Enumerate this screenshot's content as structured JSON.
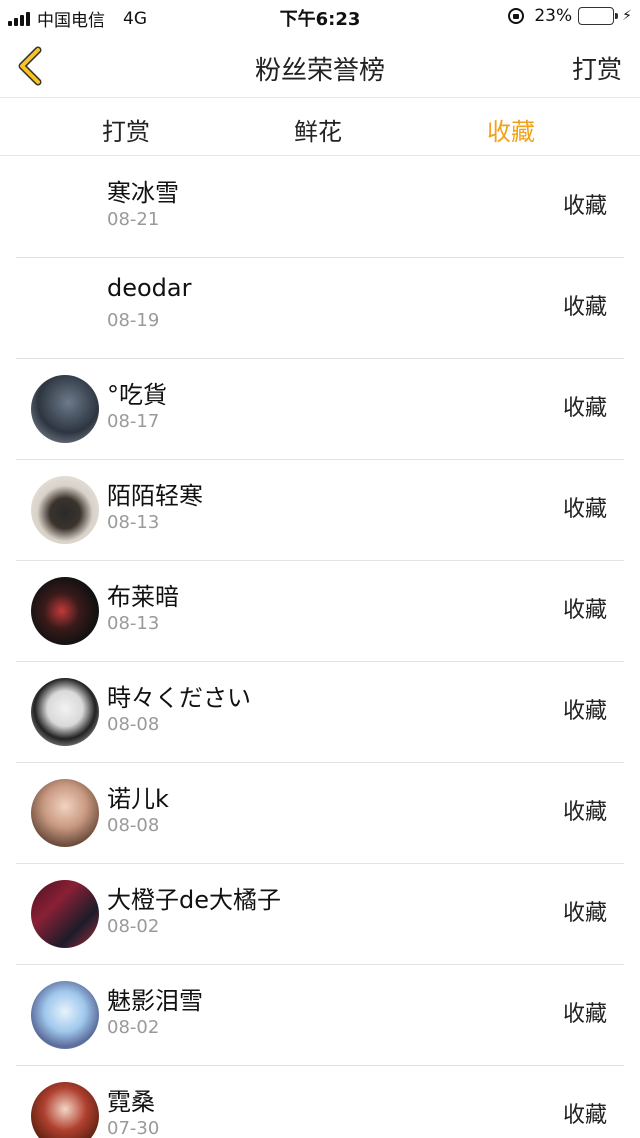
{
  "status_bar": {
    "carrier": "中国电信",
    "network": "4G",
    "time": "下午6:23",
    "battery": "23%",
    "battery_level": 0.23
  },
  "nav": {
    "back_icon": "chevron-left-icon",
    "title": "粉丝荣誉榜",
    "action": "打赏"
  },
  "tabs": [
    {
      "label": "打赏",
      "active": false
    },
    {
      "label": "鲜花",
      "active": false
    },
    {
      "label": "收藏",
      "active": true
    }
  ],
  "colors": {
    "accent": "#f0a21b",
    "back_icon": "#f7c325"
  },
  "list": [
    {
      "name": "寒冰雪",
      "date": "08-21",
      "action": "收藏",
      "avatar": "none"
    },
    {
      "name": "deodar",
      "date": "08-19",
      "action": "收藏",
      "avatar": "none"
    },
    {
      "name": "°吃貨",
      "date": "08-17",
      "action": "收藏",
      "avatar": "photo"
    },
    {
      "name": "陌陌轻寒",
      "date": "08-13",
      "action": "收藏",
      "avatar": "photo"
    },
    {
      "name": "布莱暗",
      "date": "08-13",
      "action": "收藏",
      "avatar": "photo"
    },
    {
      "name": "時々ください",
      "date": "08-08",
      "action": "收藏",
      "avatar": "photo"
    },
    {
      "name": "诺儿k",
      "date": "08-08",
      "action": "收藏",
      "avatar": "photo"
    },
    {
      "name": "大橙子de大橘子",
      "date": "08-02",
      "action": "收藏",
      "avatar": "photo"
    },
    {
      "name": "魅影泪雪",
      "date": "08-02",
      "action": "收藏",
      "avatar": "photo"
    },
    {
      "name": "霓桑",
      "date": "07-30",
      "action": "收藏",
      "avatar": "photo"
    }
  ]
}
